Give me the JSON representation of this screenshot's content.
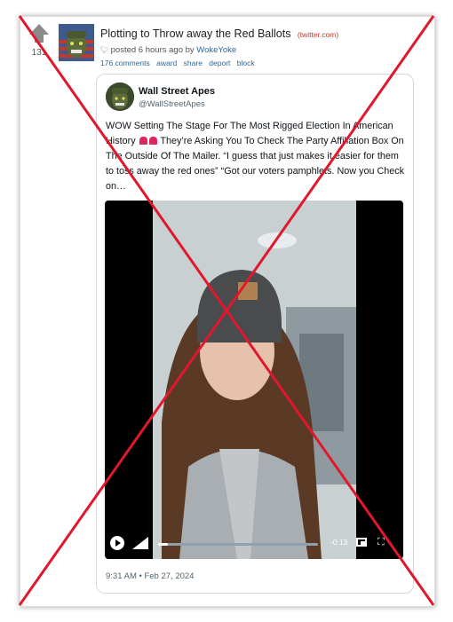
{
  "post": {
    "score": "131",
    "title": "Plotting to Throw away the Red Ballots",
    "domain": "(twitter.com)",
    "meta_prefix": "posted 6 hours ago by",
    "author": "WokeYoke",
    "actions": [
      "176 comments",
      "award",
      "share",
      "deport",
      "block"
    ]
  },
  "tweet": {
    "name": "Wall Street Apes",
    "handle": "@WallStreetApes",
    "text_part1": "WOW Setting The Stage For The Most Rigged Election In American History",
    "text_part2": "They’re Asking You To Check The Party Affiliation Box On The Outside Of The Mailer. “I guess that just makes it easier for them to toss away the red ones” “Got our voters pamphlets. Now you Check on…",
    "date": "9:31 AM • Feb 27, 2024",
    "video": {
      "time": "-0:13",
      "progress": 0.06
    }
  },
  "icons": {
    "vote": "upvote-arrow-icon",
    "twitter": "twitter-bird-icon",
    "alarm": "rotating-light-icon",
    "play": "play-icon",
    "volume": "volume-icon",
    "pip": "picture-in-picture-icon",
    "fullscreen": "fullscreen-icon"
  },
  "colors": {
    "cross": "#e0182d",
    "link": "#336699",
    "domain": "#c0392b"
  }
}
